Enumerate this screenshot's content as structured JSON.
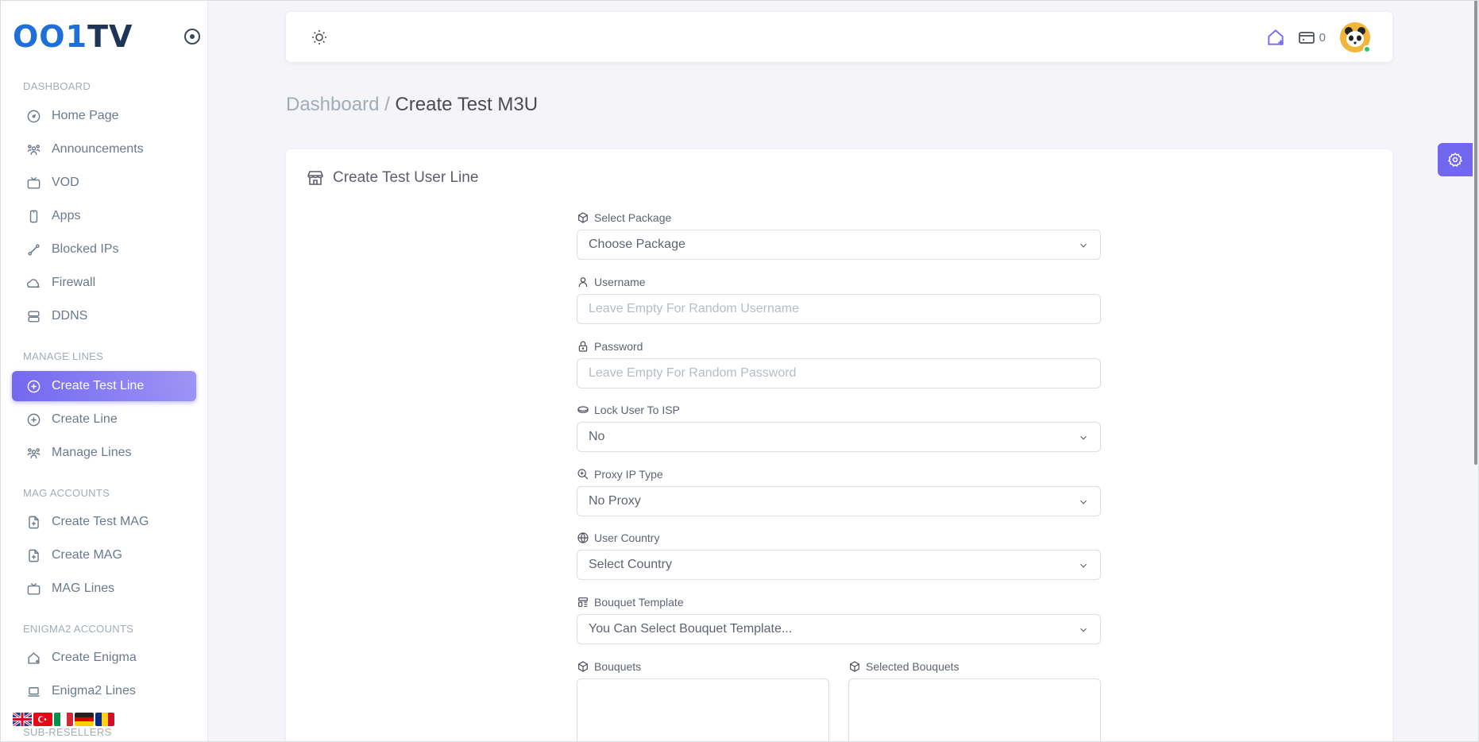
{
  "brand": {
    "text_main": "OO",
    "text_one": "1",
    "text_tv": "TV"
  },
  "sidebar": {
    "sections": {
      "dashboard": "DASHBOARD",
      "manage_lines": "MANAGE LINES",
      "mag_accounts": "MAG ACCOUNTS",
      "enigma2_accounts": "ENIGMA2 ACCOUNTS",
      "sub_resellers": "SUB-RESELLERS"
    },
    "items": {
      "home_page": "Home Page",
      "announcements": "Announcements",
      "vod": "VOD",
      "apps": "Apps",
      "blocked_ips": "Blocked IPs",
      "firewall": "Firewall",
      "ddns": "DDNS",
      "create_test_line": "Create Test Line",
      "create_line": "Create Line",
      "manage_lines": "Manage Lines",
      "create_test_mag": "Create Test MAG",
      "create_mag": "Create MAG",
      "mag_lines": "MAG Lines",
      "create_enigma": "Create Enigma",
      "enigma2_lines": "Enigma2 Lines"
    },
    "active_item": "create_test_line",
    "language_flags": [
      "uk-flag",
      "turkey-flag",
      "italy-flag",
      "germany-flag",
      "romania-flag"
    ]
  },
  "navbar": {
    "balance": "0"
  },
  "breadcrumb": {
    "parent": "Dashboard /",
    "current": "Create Test M3U"
  },
  "card": {
    "title": "Create Test User Line",
    "fields": {
      "package": {
        "label": "Select Package",
        "value": "Choose Package"
      },
      "username": {
        "label": "Username",
        "placeholder": "Leave Empty For Random Username"
      },
      "password": {
        "label": "Password",
        "placeholder": "Leave Empty For Random Password"
      },
      "isp": {
        "label": "Lock User To ISP",
        "value": "No"
      },
      "proxy": {
        "label": "Proxy IP Type",
        "value": "No Proxy"
      },
      "country": {
        "label": "User Country",
        "value": "Select Country"
      },
      "bouquet_template": {
        "label": "Bouquet Template",
        "value": "You Can Select Bouquet Template..."
      },
      "bouquets": {
        "label": "Bouquets"
      },
      "selected_bouquets": {
        "label": "Selected Bouquets"
      }
    }
  },
  "colors": {
    "accent": "#7367f0",
    "text": "#697a8d",
    "muted": "#a1acb8",
    "status_online": "#28c76f"
  }
}
